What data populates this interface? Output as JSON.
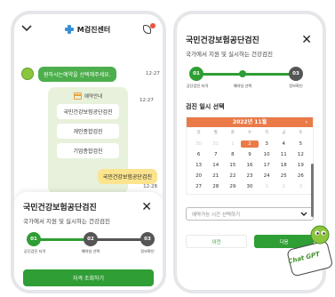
{
  "left": {
    "header": {
      "title": "M검진센터",
      "back_icon": "chevron-down-icon",
      "call_icon": "phone-icon"
    },
    "chat": {
      "bot_message": "원하시는예약을 선택해주세요.",
      "bot_time": "12:27",
      "menu_title": "예약안내",
      "menu_time": "12:27",
      "menu_items": [
        "국민건강보험공단검진",
        "개인종합검진",
        "기업종합검진"
      ],
      "reply": "국민건강보험공단검진",
      "reply_time": "12:28"
    },
    "sheet": {
      "title": "국민건강보험공단검진",
      "subtitle": "국가에서 지원 및 실시하는 건강검진",
      "steps": [
        {
          "num": "01",
          "label": "공단검진 자격"
        },
        {
          "num": "02",
          "label": "예약일 선택"
        },
        {
          "num": "03",
          "label": "정보확인"
        }
      ],
      "button": "자격 조회하기"
    }
  },
  "right": {
    "title": "국민건강보험공단검진",
    "subtitle": "국가에서 지원 및 실시하는 건강검진",
    "steps": [
      {
        "num": "01",
        "label": "공단검진 자격"
      },
      {
        "num": "02",
        "label": "예약일 선택"
      },
      {
        "num": "03",
        "label": "정보확인"
      }
    ],
    "section_title": "검진 일시 선택",
    "calendar": {
      "month": "2022년 11월",
      "weekdays": [
        "일",
        "월",
        "화",
        "수",
        "목",
        "금",
        "토"
      ],
      "rows": [
        [
          "30",
          "31",
          "1",
          "2",
          "3",
          "4",
          "5"
        ],
        [
          "6",
          "7",
          "8",
          "9",
          "10",
          "11",
          "12"
        ],
        [
          "13",
          "14",
          "15",
          "16",
          "17",
          "18",
          "19"
        ],
        [
          "20",
          "21",
          "22",
          "23",
          "24",
          "25",
          "26"
        ],
        [
          "27",
          "28",
          "29",
          "30",
          "1",
          "2",
          "3"
        ]
      ],
      "selected": "2"
    },
    "time_select_placeholder": "예약가능 시간 선택하기",
    "prev_button": "이전",
    "next_button": "다음"
  },
  "mascot": {
    "text": "Chat GPT"
  },
  "colors": {
    "green": "#2f9e35",
    "orange": "#ea7a48",
    "grey": "#555555",
    "yellow": "#fbe48d"
  }
}
